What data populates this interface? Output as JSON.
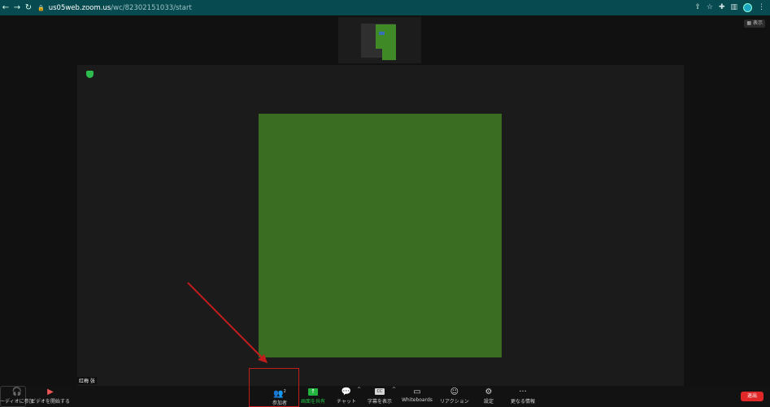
{
  "browser": {
    "back_glyph": "←",
    "forward_glyph": "→",
    "reload_glyph": "↻",
    "url_host": "us05web.zoom.us",
    "url_path": "/wc/82302151033/start"
  },
  "meeting": {
    "view_button": "表示",
    "participant_name": "红梅 张"
  },
  "toolbar": {
    "audio_label": "ーディオに参加",
    "video_label": "ビデオを開始する",
    "participants_label": "参加者",
    "participants_count": "2",
    "share_label": "画面を共有",
    "chat_label": "チャット",
    "captions_label": "字幕を表示",
    "whiteboards_label": "Whiteboards",
    "reactions_label": "リアクション",
    "settings_label": "設定",
    "more_label": "更なる情報",
    "end_label": "退出"
  },
  "colors": {
    "chrome": "#074a4f",
    "share_green": "#3a6d21",
    "annotation_red": "#c21d1d",
    "end_red": "#e02828",
    "share_icon_green": "#23b43f"
  },
  "icons": {
    "audio": "headphones-icon",
    "video": "video-off-icon",
    "participants": "people-icon",
    "share": "share-screen-icon",
    "chat": "chat-bubble-icon",
    "captions": "cc-icon",
    "whiteboards": "whiteboard-icon",
    "reactions": "emoji-icon",
    "settings": "gear-icon",
    "more": "ellipsis-icon"
  }
}
